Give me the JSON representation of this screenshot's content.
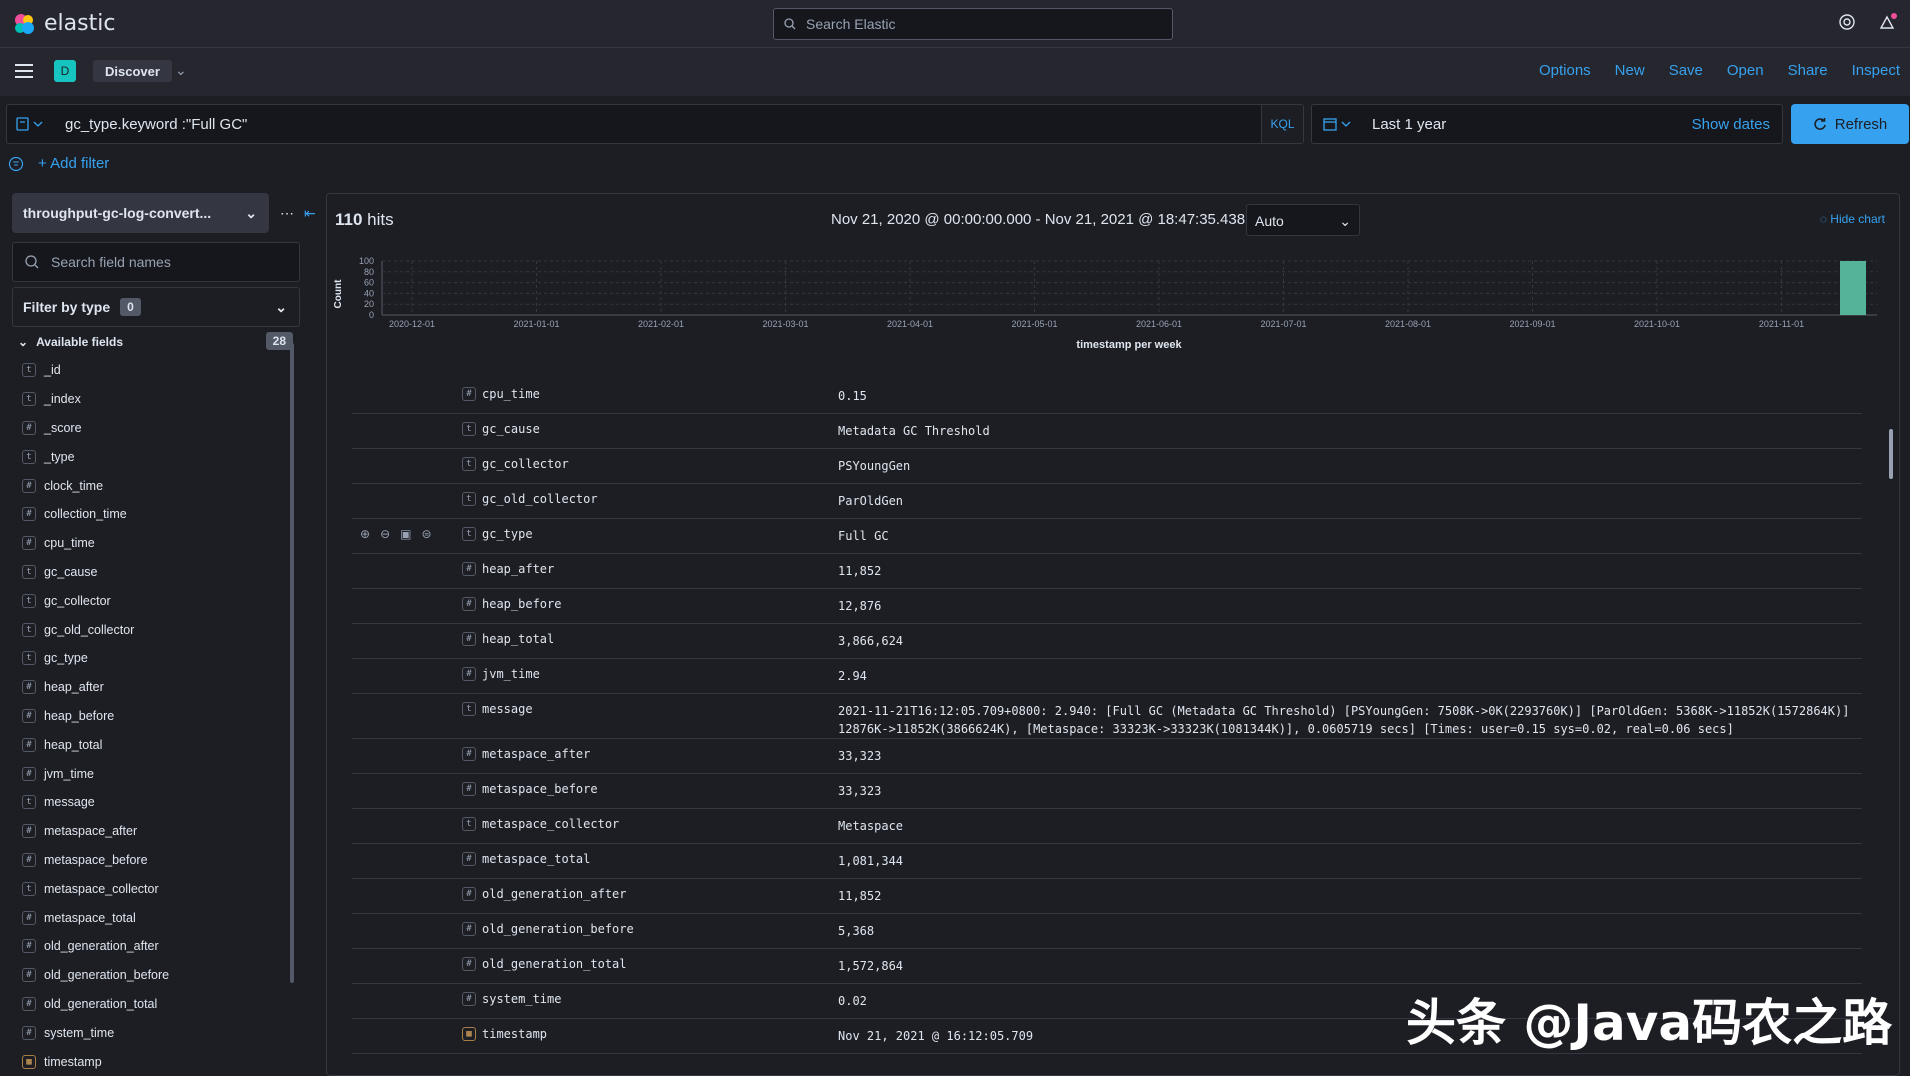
{
  "topbar": {
    "brand": "elastic",
    "search_placeholder": "Search Elastic"
  },
  "navbar": {
    "space_initial": "D",
    "breadcrumb": "Discover",
    "actions": [
      "Options",
      "New",
      "Save",
      "Open",
      "Share",
      "Inspect"
    ]
  },
  "query": {
    "text": "gc_type.keyword :\"Full GC\"",
    "language": "KQL"
  },
  "date": {
    "label": "Last 1 year",
    "show_dates": "Show dates",
    "refresh": "Refresh"
  },
  "filters": {
    "add_filter": "+ Add filter"
  },
  "sidebar": {
    "index_pattern": "throughput-gc-log-convert...",
    "search_placeholder": "Search field names",
    "filter_by_type": "Filter by type",
    "filter_count": "0",
    "available_fields": "Available fields",
    "available_count": "28",
    "fields": [
      {
        "type": "t",
        "name": "_id"
      },
      {
        "type": "t",
        "name": "_index"
      },
      {
        "type": "#",
        "name": "_score"
      },
      {
        "type": "t",
        "name": "_type"
      },
      {
        "type": "#",
        "name": "clock_time"
      },
      {
        "type": "#",
        "name": "collection_time"
      },
      {
        "type": "#",
        "name": "cpu_time"
      },
      {
        "type": "t",
        "name": "gc_cause"
      },
      {
        "type": "t",
        "name": "gc_collector"
      },
      {
        "type": "t",
        "name": "gc_old_collector"
      },
      {
        "type": "t",
        "name": "gc_type"
      },
      {
        "type": "#",
        "name": "heap_after"
      },
      {
        "type": "#",
        "name": "heap_before"
      },
      {
        "type": "#",
        "name": "heap_total"
      },
      {
        "type": "#",
        "name": "jvm_time"
      },
      {
        "type": "t",
        "name": "message"
      },
      {
        "type": "#",
        "name": "metaspace_after"
      },
      {
        "type": "#",
        "name": "metaspace_before"
      },
      {
        "type": "t",
        "name": "metaspace_collector"
      },
      {
        "type": "#",
        "name": "metaspace_total"
      },
      {
        "type": "#",
        "name": "old_generation_after"
      },
      {
        "type": "#",
        "name": "old_generation_before"
      },
      {
        "type": "#",
        "name": "old_generation_total"
      },
      {
        "type": "#",
        "name": "system_time"
      },
      {
        "type": "date",
        "name": "timestamp"
      }
    ]
  },
  "results": {
    "hits_count": "110",
    "hits_label": "hits",
    "time_range": "Nov 21, 2020 @ 00:00:00.000 - Nov 21, 2021 @ 18:47:35.438",
    "interval": "Auto",
    "hide_chart": "Hide chart"
  },
  "chart_data": {
    "type": "bar",
    "ylabel": "Count",
    "xlabel": "timestamp per week",
    "yticks": [
      "100",
      "80",
      "60",
      "40",
      "20",
      "0"
    ],
    "ylim": [
      0,
      100
    ],
    "xticks": [
      "2020-12-01",
      "2021-01-01",
      "2021-02-01",
      "2021-03-01",
      "2021-04-01",
      "2021-05-01",
      "2021-06-01",
      "2021-07-01",
      "2021-08-01",
      "2021-09-01",
      "2021-10-01",
      "2021-11-01"
    ],
    "bars": [
      {
        "x": "2021-11-15",
        "value": 110
      }
    ],
    "bar_color": "#54b399"
  },
  "document": [
    {
      "type": "#",
      "field": "cpu_time",
      "value": "0.15"
    },
    {
      "type": "t",
      "field": "gc_cause",
      "value": "Metadata GC Threshold"
    },
    {
      "type": "t",
      "field": "gc_collector",
      "value": "PSYoungGen"
    },
    {
      "type": "t",
      "field": "gc_old_collector",
      "value": "ParOldGen"
    },
    {
      "type": "t",
      "field": "gc_type",
      "value": "Full GC",
      "actions": true
    },
    {
      "type": "#",
      "field": "heap_after",
      "value": "11,852"
    },
    {
      "type": "#",
      "field": "heap_before",
      "value": "12,876"
    },
    {
      "type": "#",
      "field": "heap_total",
      "value": "3,866,624"
    },
    {
      "type": "#",
      "field": "jvm_time",
      "value": "2.94"
    },
    {
      "type": "t",
      "field": "message",
      "value": "2021-11-21T16:12:05.709+0800: 2.940: [Full GC (Metadata GC Threshold) [PSYoungGen: 7508K->0K(2293760K)] [ParOldGen: 5368K->11852K(1572864K)] 12876K->11852K(3866624K), [Metaspace: 33323K->33323K(1081344K)], 0.0605719 secs] [Times: user=0.15 sys=0.02, real=0.06 secs]"
    },
    {
      "type": "#",
      "field": "metaspace_after",
      "value": "33,323"
    },
    {
      "type": "#",
      "field": "metaspace_before",
      "value": "33,323"
    },
    {
      "type": "t",
      "field": "metaspace_collector",
      "value": "Metaspace"
    },
    {
      "type": "#",
      "field": "metaspace_total",
      "value": "1,081,344"
    },
    {
      "type": "#",
      "field": "old_generation_after",
      "value": "11,852"
    },
    {
      "type": "#",
      "field": "old_generation_before",
      "value": "5,368"
    },
    {
      "type": "#",
      "field": "old_generation_total",
      "value": "1,572,864"
    },
    {
      "type": "#",
      "field": "system_time",
      "value": "0.02"
    },
    {
      "type": "date",
      "field": "timestamp",
      "value": "Nov 21, 2021 @ 16:12:05.709"
    }
  ],
  "watermark": "头条 @Java码农之路"
}
